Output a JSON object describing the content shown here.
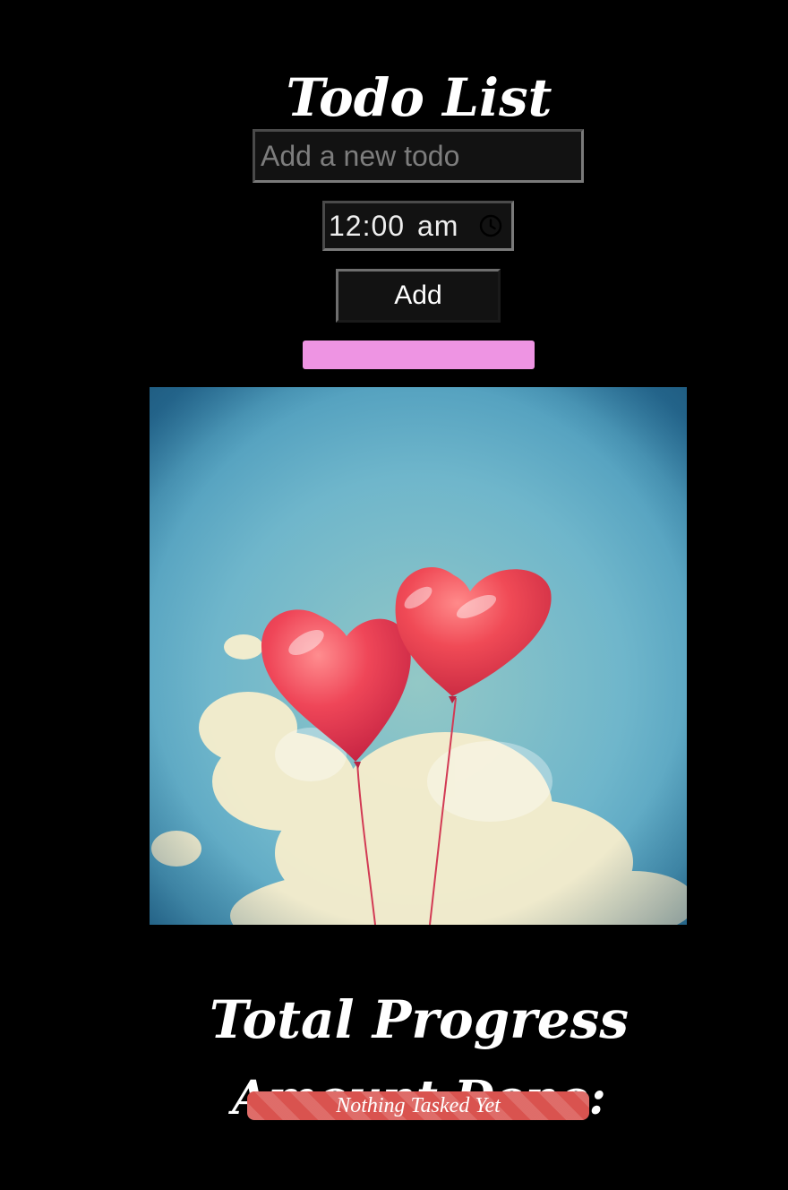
{
  "header": {
    "title": "Todo List"
  },
  "form": {
    "todo_placeholder": "Add a new todo",
    "todo_value": "",
    "time_value": "12:00 am",
    "add_label": "Add"
  },
  "progress": {
    "heading": "Total Progress",
    "subheading": "Amount Done:",
    "status_text": "Nothing Tasked Yet",
    "completion": 0
  },
  "icons": {
    "time_picker": "clock-icon"
  },
  "colors": {
    "background": "#000000",
    "accent_bar": "#ee94e3",
    "progress_bar": "#d9534f"
  }
}
